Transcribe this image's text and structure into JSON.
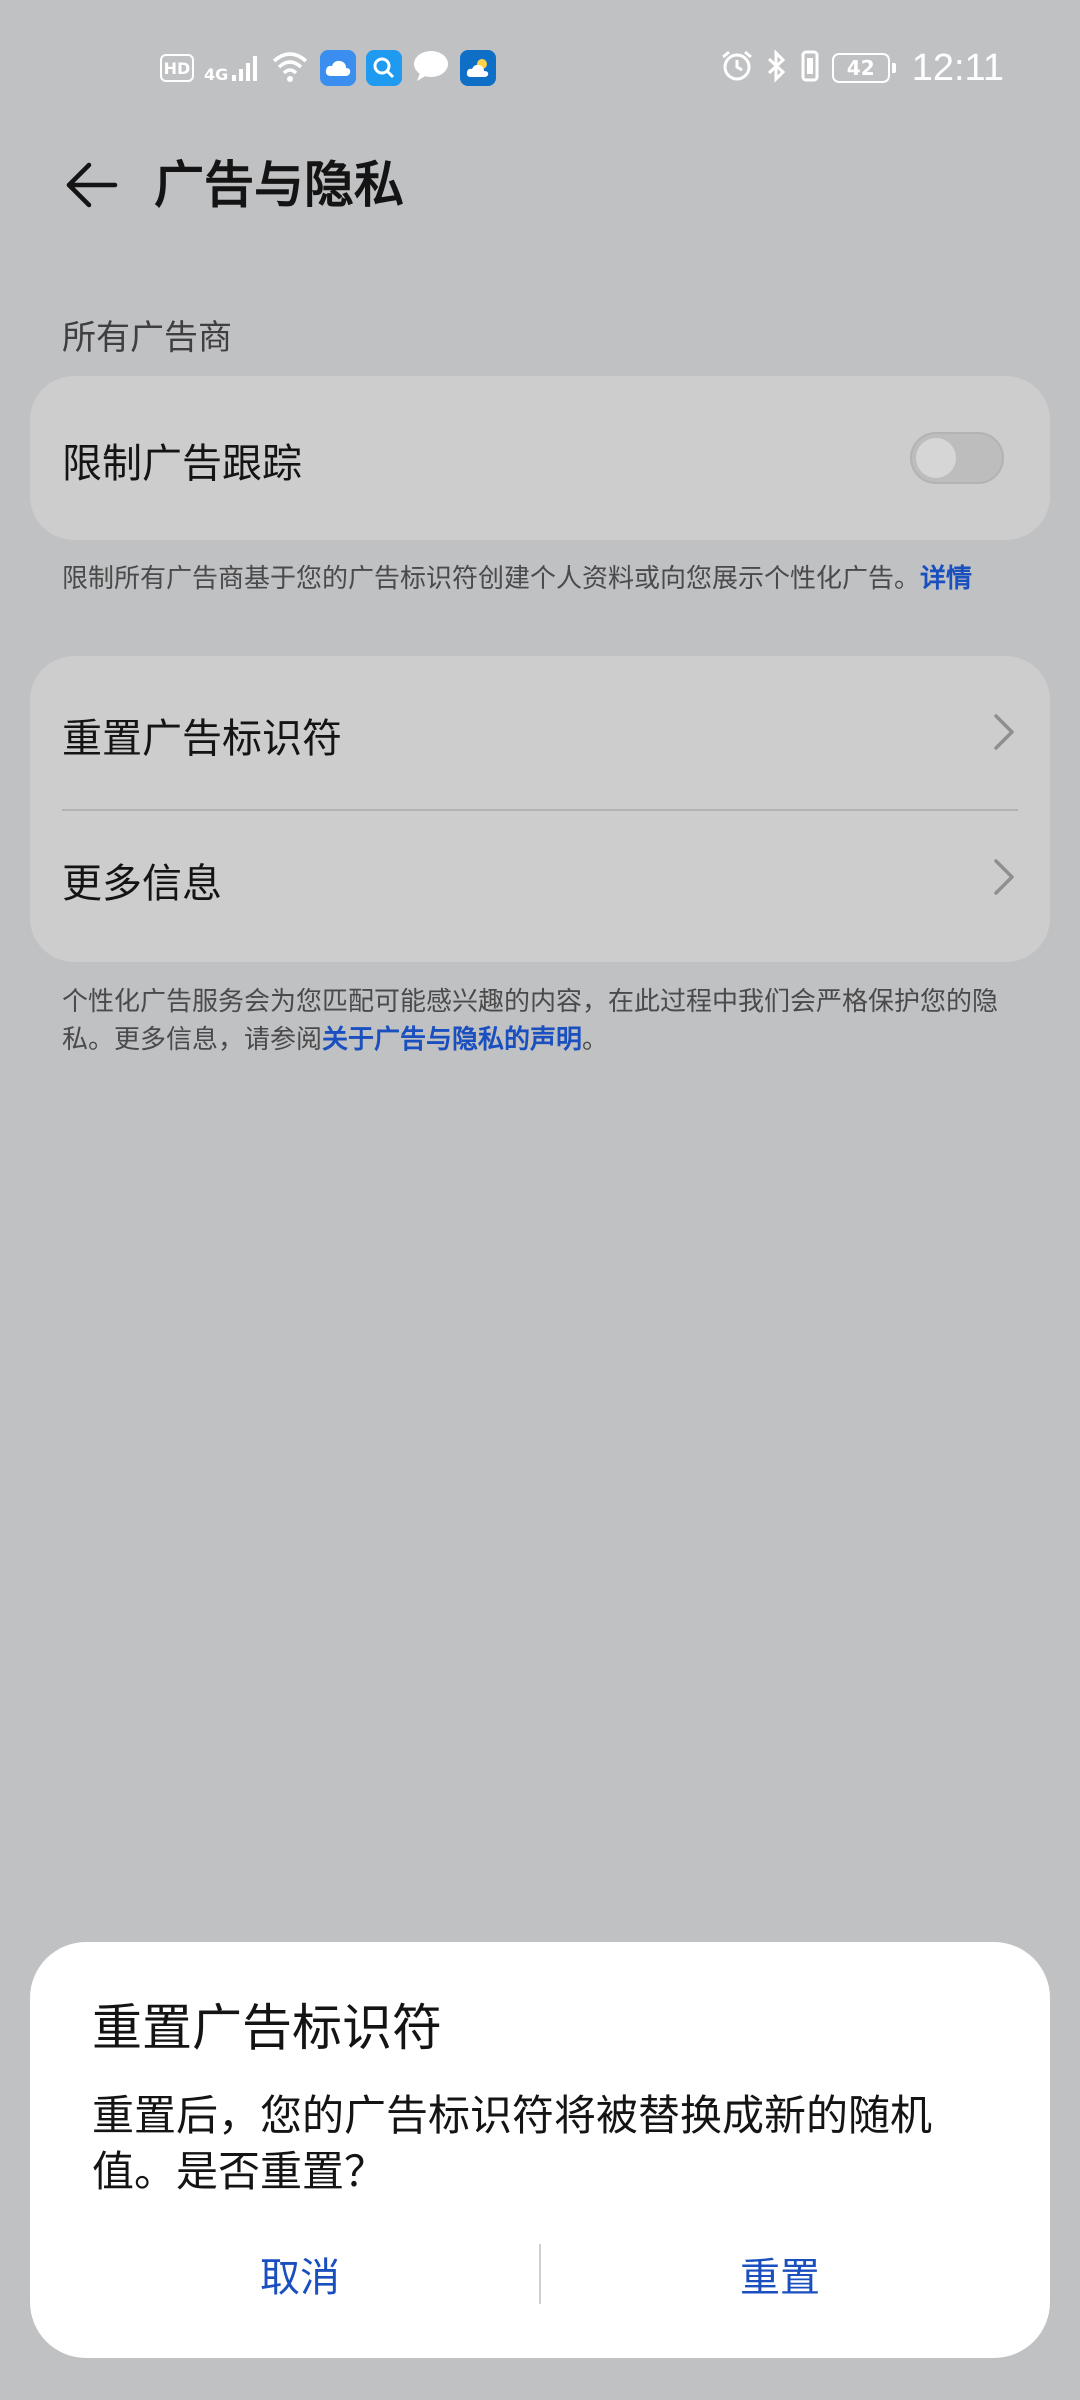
{
  "status_bar": {
    "hd": "HD",
    "network": "4G",
    "time": "12:11",
    "battery": "42",
    "icons": [
      "wifi-icon",
      "cloud-app-icon",
      "search-app-icon",
      "message-icon",
      "weather-app-icon",
      "alarm-icon",
      "bluetooth-icon",
      "vibrate-icon"
    ]
  },
  "header": {
    "title": "广告与隐私"
  },
  "section": {
    "all_advertisers": "所有广告商"
  },
  "limit_tracking": {
    "label": "限制广告跟踪",
    "enabled": false,
    "hint": "限制所有广告商基于您的广告标识符创建个人资料或向您展示个性化广告。",
    "hint_link": "详情"
  },
  "menu": {
    "items": [
      {
        "label": "重置广告标识符"
      },
      {
        "label": "更多信息"
      }
    ]
  },
  "footer_hint": {
    "text": "个性化广告服务会为您匹配可能感兴趣的内容，在此过程中我们会严格保护您的隐私。更多信息，请参阅",
    "link": "关于广告与隐私的声明",
    "tail": "。"
  },
  "dialog": {
    "title": "重置广告标识符",
    "message": "重置后，您的广告标识符将被替换成新的随机值。是否重置？",
    "cancel": "取消",
    "confirm": "重置"
  },
  "colors": {
    "background": "#c0c1c3",
    "card": "#cdcdce",
    "accent": "#1a4fbf",
    "dialog": "#ffffff"
  }
}
